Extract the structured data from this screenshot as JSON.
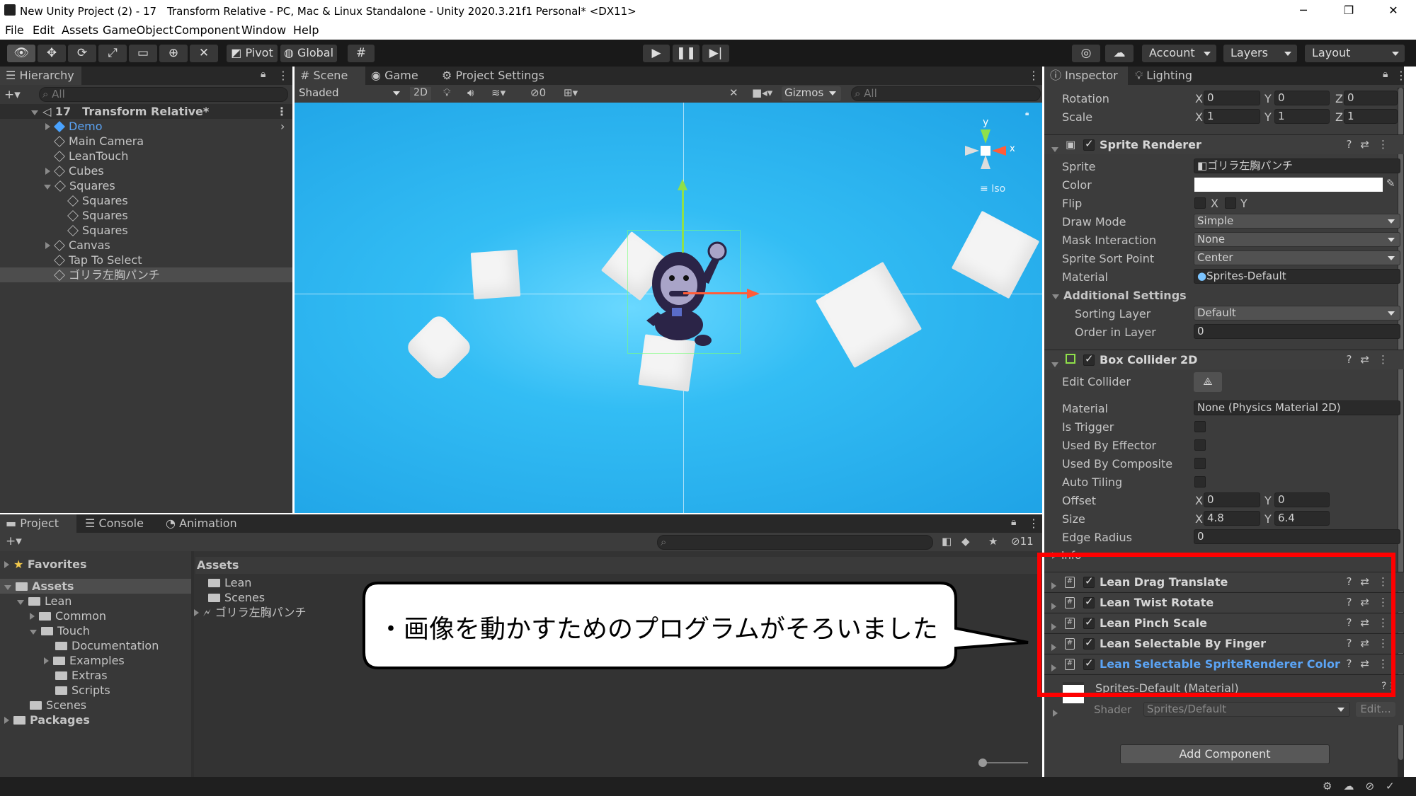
{
  "window": {
    "title": "New Unity Project (2) - 17　Transform Relative - PC, Mac & Linux Standalone - Unity 2020.3.21f1 Personal* <DX11>",
    "minimize": "─",
    "restore": "❐",
    "close": "✕"
  },
  "menu": [
    "File",
    "Edit",
    "Assets",
    "GameObject",
    "Component",
    "Window",
    "Help"
  ],
  "toolbar": {
    "pivot": "Pivot",
    "global": "Global",
    "account": "Account",
    "layers": "Layers",
    "layout": "Layout"
  },
  "hierarchy": {
    "tab": "Hierarchy",
    "search_placeholder": "All",
    "scene": "17　Transform Relative*",
    "items": [
      {
        "label": "Demo"
      },
      {
        "label": "Main Camera"
      },
      {
        "label": "LeanTouch"
      },
      {
        "label": "Cubes"
      },
      {
        "label": "Squares"
      },
      {
        "label": "Squares"
      },
      {
        "label": "Squares"
      },
      {
        "label": "Squares"
      },
      {
        "label": "Canvas"
      },
      {
        "label": "Tap To Select"
      },
      {
        "label": "ゴリラ左胸パンチ"
      }
    ]
  },
  "scene_view": {
    "tabs": [
      "Scene",
      "Game",
      "Project Settings"
    ],
    "shading": "Shaded",
    "mode_2d": "2D",
    "hidden_count": "0",
    "gizmos": "Gizmos",
    "search_placeholder": "All",
    "axis_x": "x",
    "axis_y": "y",
    "iso": "Iso"
  },
  "project": {
    "tabs": [
      "Project",
      "Console",
      "Animation"
    ],
    "favorites": "Favorites",
    "tree": [
      {
        "label": "Assets"
      },
      {
        "label": "Lean"
      },
      {
        "label": "Common"
      },
      {
        "label": "Touch"
      },
      {
        "label": "Documentation"
      },
      {
        "label": "Examples"
      },
      {
        "label": "Extras"
      },
      {
        "label": "Scripts"
      },
      {
        "label": "Scenes"
      },
      {
        "label": "Packages"
      }
    ],
    "assets_header": "Assets",
    "assets": [
      {
        "label": "Lean"
      },
      {
        "label": "Scenes"
      },
      {
        "label": "ゴリラ左胸パンチ"
      }
    ],
    "hidden_count": "11"
  },
  "callout": {
    "text": "・画像を動かすためのプログラムがそろいました"
  },
  "inspector": {
    "tabs": [
      "Inspector",
      "Lighting"
    ],
    "rotation": {
      "label": "Rotation",
      "x": "0",
      "y": "0",
      "z": "0"
    },
    "scale": {
      "label": "Scale",
      "x": "1",
      "y": "1",
      "z": "1"
    },
    "axis_labels": {
      "x": "X",
      "y": "Y",
      "z": "Z"
    },
    "sprite_renderer": {
      "title": "Sprite Renderer",
      "sprite_label": "Sprite",
      "sprite_value": "ゴリラ左胸パンチ",
      "color_label": "Color",
      "flip_label": "Flip",
      "flip_x": "X",
      "flip_y": "Y",
      "draw_mode_label": "Draw Mode",
      "draw_mode_value": "Simple",
      "mask_label": "Mask Interaction",
      "mask_value": "None",
      "sort_point_label": "Sprite Sort Point",
      "sort_point_value": "Center",
      "material_label": "Material",
      "material_value": "Sprites-Default",
      "additional": "Additional Settings",
      "sorting_layer_label": "Sorting Layer",
      "sorting_layer_value": "Default",
      "order_label": "Order in Layer",
      "order_value": "0"
    },
    "box_collider": {
      "title": "Box Collider 2D",
      "edit_label": "Edit Collider",
      "material_label": "Material",
      "material_value": "None (Physics Material 2D)",
      "trigger_label": "Is Trigger",
      "effector_label": "Used By Effector",
      "composite_label": "Used By Composite",
      "tiling_label": "Auto Tiling",
      "offset_label": "Offset",
      "offset_x": "0",
      "offset_y": "0",
      "size_label": "Size",
      "size_x": "4.8",
      "size_y": "6.4",
      "edge_label": "Edge Radius",
      "edge_value": "0",
      "info_label": "Info"
    },
    "scripts": [
      {
        "name": "Lean Drag Translate",
        "color": "#d7d7d7"
      },
      {
        "name": "Lean Twist Rotate",
        "color": "#d7d7d7"
      },
      {
        "name": "Lean Pinch Scale",
        "color": "#d7d7d7"
      },
      {
        "name": "Lean Selectable By Finger",
        "color": "#d7d7d7"
      },
      {
        "name": "Lean Selectable SpriteRenderer Color",
        "color": "#5ba4f5"
      }
    ],
    "material": {
      "name": "Sprites-Default (Material)",
      "shader_label": "Shader",
      "shader_value": "Sprites/Default",
      "edit": "Edit..."
    },
    "add_component": "Add Component"
  },
  "colors": {
    "scene_bg": "#2bb0ee",
    "highlight_red": "#ff0000",
    "link_blue": "#5ba4f5"
  }
}
